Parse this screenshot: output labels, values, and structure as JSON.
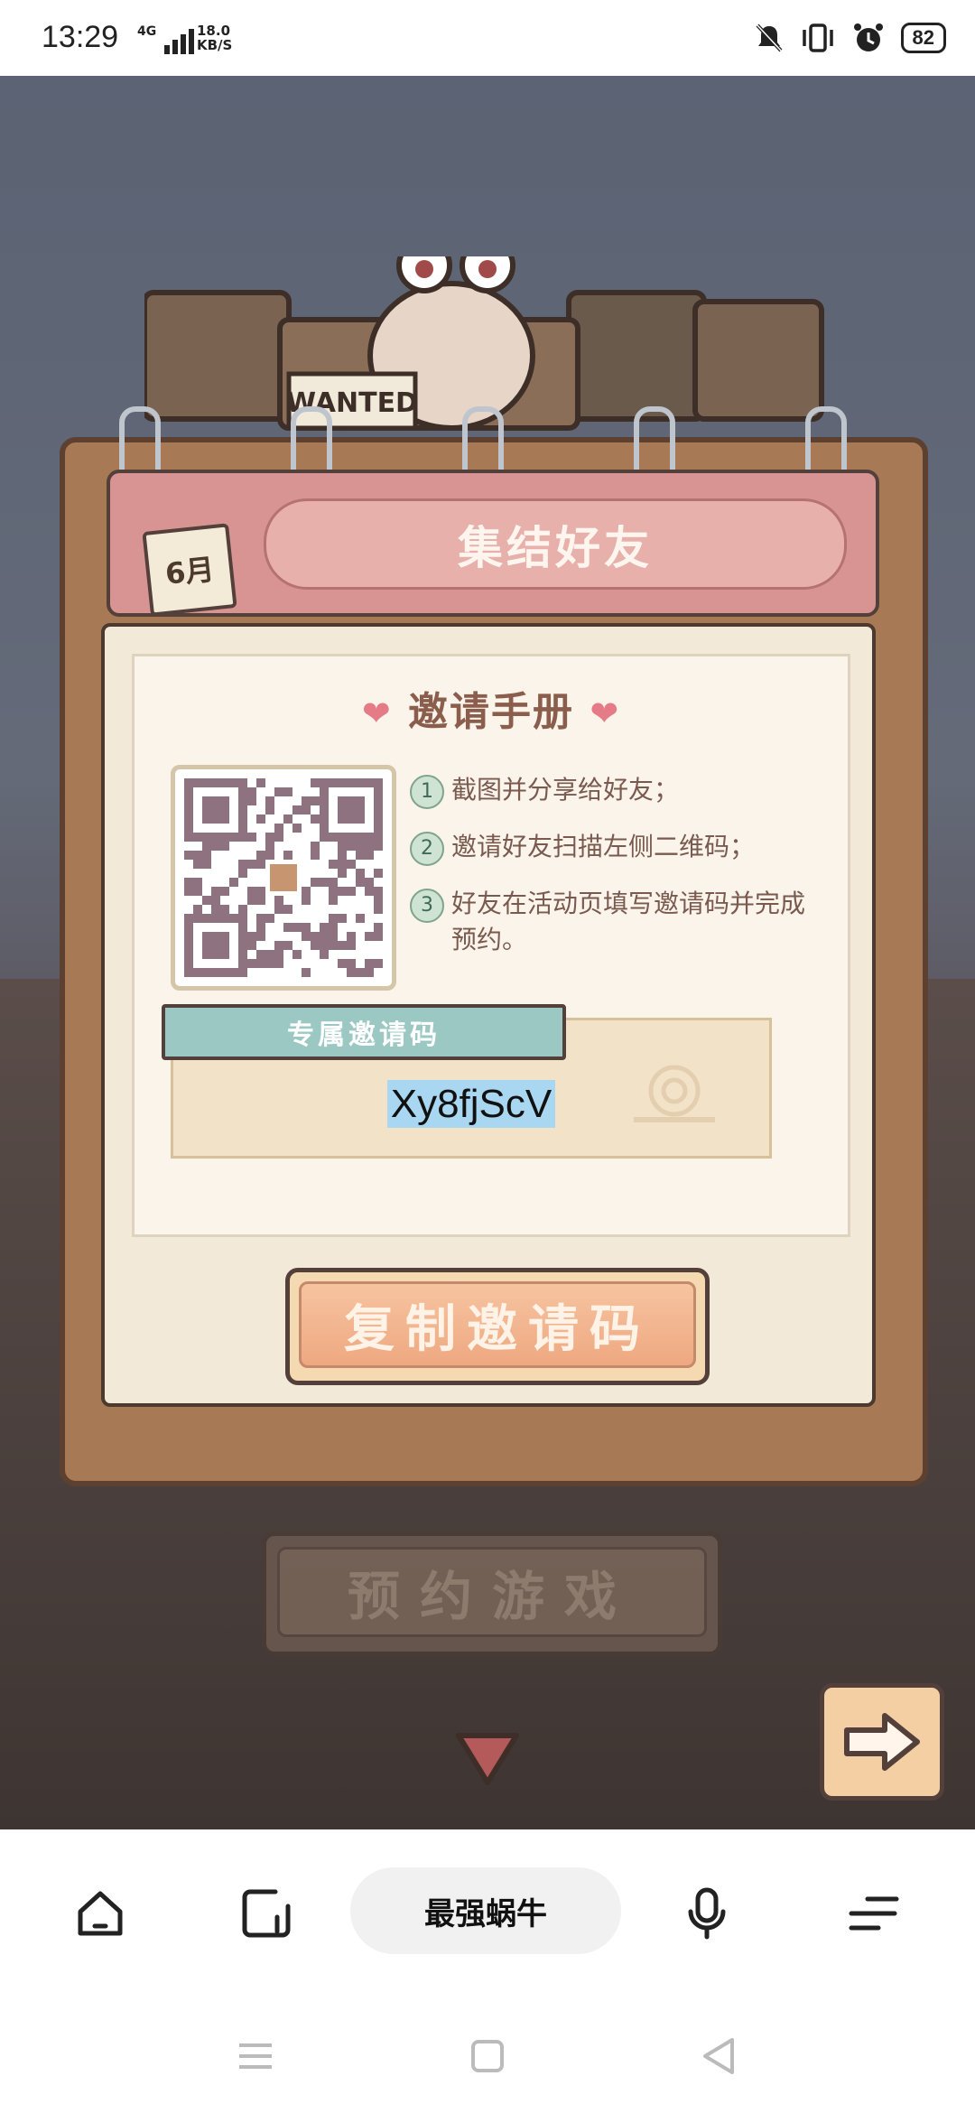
{
  "status_bar": {
    "time": "13:29",
    "network": "4G",
    "speed_value": "18.0",
    "speed_unit": "KB/S",
    "battery": "82"
  },
  "game": {
    "header_title": "集结好友",
    "calendar_label": "6月",
    "wanted_sign": "WANTED",
    "card_title": "邀请手册",
    "steps": [
      {
        "num": "1",
        "text": "截图并分享给好友；"
      },
      {
        "num": "2",
        "text": "邀请好友扫描左侧二维码；"
      },
      {
        "num": "3",
        "text": "好友在活动页填写邀请码并完成预约。"
      }
    ],
    "code_label": "专属邀请码",
    "invite_code": "Xy8fjScV",
    "copy_button": "复制邀请码",
    "reserve_button": "预约游戏"
  },
  "browser": {
    "title": "最强蜗牛"
  },
  "colors": {
    "accent_pink": "#d89493",
    "book_wood": "#a77a55",
    "button_peach": "#eea881"
  }
}
